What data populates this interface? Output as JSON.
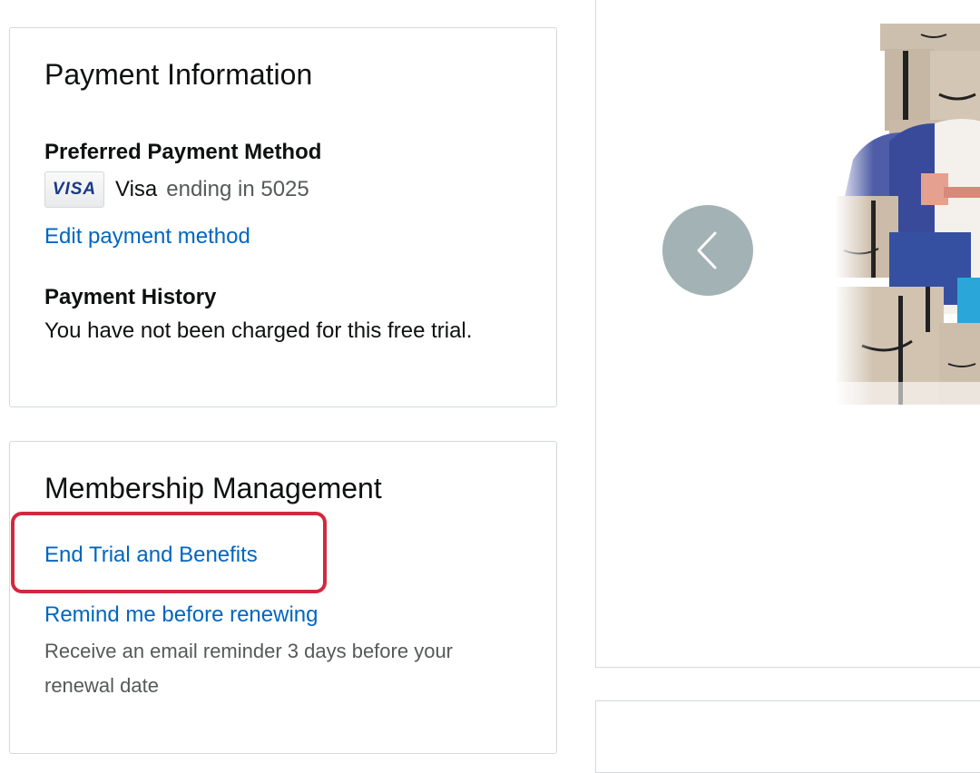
{
  "payment_card": {
    "title": "Payment Information",
    "preferred_label": "Preferred Payment Method",
    "card_logo": "VISA",
    "card_name": "Visa",
    "card_ending": "ending in 5025",
    "edit_link": "Edit payment method",
    "history_label": "Payment History",
    "history_text": "You have not been charged for this free trial."
  },
  "membership_card": {
    "title": "Membership Management",
    "end_trial_link": "End Trial and Benefits",
    "remind_link": "Remind me before renewing",
    "remind_desc_line1": "Receive an email reminder 3 days before your",
    "remind_desc_line2": "renewal date"
  },
  "carousel": {
    "prev_icon": "chevron-left-icon"
  },
  "colors": {
    "link": "#0066c0",
    "highlight": "#d0293f",
    "carousel_button": "#a3b2b4"
  }
}
